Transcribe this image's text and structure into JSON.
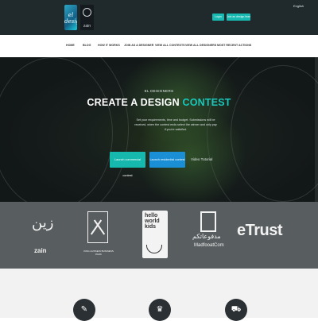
{
  "header": {
    "logo_primary_text": "el designers",
    "logo_secondary_text": "zain",
    "login_label": "Login",
    "join_label": "Join as design team",
    "language_label": "English"
  },
  "nav": {
    "items": [
      "HOME",
      "BLOG",
      "HOW IT WORKS",
      "JOIN AS A DESIGNER",
      "VIEW ALL CONTESTS",
      "VIEW ALL DESIGNERS",
      "MOST RECENT ACTIONS"
    ]
  },
  "hero": {
    "sub_brand": "EL DESIGNERS",
    "headline_main": "CREATE A DESIGN ",
    "headline_accent": "CONTEST",
    "description": "Set your requirements, time and budget. Submissions will be received, when the contest ends select the winner and only pay if you're satisfied.",
    "cta_commercial": "Launch commercial contest",
    "cta_residential": "Launch residential contest",
    "video_label": "Video Tutorial"
  },
  "partners": {
    "zain_arabic": "زين",
    "zain_english": "zain",
    "khalid_text": "KING HUSSEIN BUSINESS PARK",
    "hello_world_kids": "hello world kids",
    "madfooatcom_arabic": "مدفوعاتكم",
    "madfooatcom_english": "MadfooatCom",
    "etrust": "eTrust"
  },
  "bottom": {
    "icons": [
      "palette-icon",
      "trophy-icon",
      "cart-icon"
    ]
  },
  "colors": {
    "accent": "#19c7bb",
    "blue": "#1a8fd6",
    "header_bg": "#20292c",
    "band_bg": "#585d5f"
  }
}
